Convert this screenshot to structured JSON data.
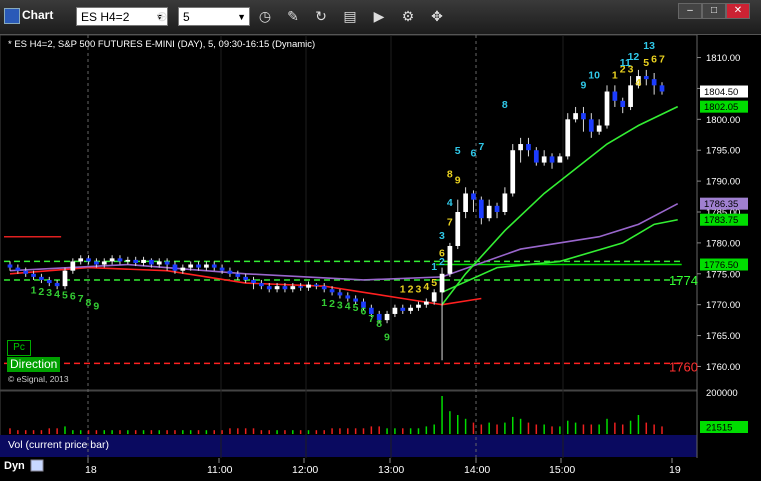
{
  "window": {
    "title": "Chart"
  },
  "toolbar": {
    "symbol": "ES H4=2",
    "interval": "5"
  },
  "chart_data": {
    "type": "candlestick",
    "header": "* ES H4=2, S&P 500 FUTURES E-MINI (DAY), 5, 09:30-16:15 (Dynamic)",
    "price_axis": {
      "range": [
        1757,
        1813
      ],
      "ticks": [
        "1810.00",
        "1805.00",
        "1800.00",
        "1795.00",
        "1790.00",
        "1785.00",
        "1780.00",
        "1775.00",
        "1770.00",
        "1765.00",
        "1760.00"
      ]
    },
    "time_axis": {
      "ticks": [
        "18",
        "11:00",
        "12:00",
        "13:00",
        "14:00",
        "15:00",
        "19"
      ]
    },
    "price_markers": [
      {
        "value": 1804.5,
        "label": "1804.50",
        "color": "#ffffff"
      },
      {
        "value": 1802.05,
        "label": "1802.05",
        "color": "#00dd00"
      },
      {
        "value": 1786.35,
        "label": "1786.35",
        "color": "#a080d0"
      },
      {
        "value": 1783.75,
        "label": "1783.75",
        "color": "#00dd00"
      },
      {
        "value": 1776.5,
        "label": "1776.50",
        "color": "#00dd00"
      }
    ],
    "level_labels": [
      {
        "value": 1774,
        "label": "1774",
        "color": "#33ff33"
      },
      {
        "value": 1760,
        "label": "1760",
        "color": "#ff3030"
      }
    ],
    "candles": [
      [
        1776.5,
        1776,
        1777,
        1775.5
      ],
      [
        1776,
        1775.5,
        1776.5,
        1775
      ],
      [
        1775.5,
        1775,
        1776,
        1774.5
      ],
      [
        1775,
        1774.5,
        1775.5,
        1774
      ],
      [
        1774.5,
        1774,
        1775,
        1773.5
      ],
      [
        1774,
        1773.5,
        1774.5,
        1773
      ],
      [
        1773.5,
        1773,
        1774,
        1772.5
      ],
      [
        1773,
        1775.5,
        1776,
        1772.5
      ],
      [
        1775.5,
        1777,
        1777.5,
        1775
      ],
      [
        1777,
        1777.5,
        1778,
        1776.5
      ],
      [
        1777.5,
        1777,
        1778,
        1776.5
      ],
      [
        1777,
        1776.5,
        1777.5,
        1776
      ],
      [
        1776.5,
        1777,
        1777.5,
        1776
      ],
      [
        1777,
        1777.5,
        1778,
        1776.5
      ],
      [
        1777.5,
        1777,
        1778,
        1776.5
      ],
      [
        1777,
        1777.25,
        1777.75,
        1776.5
      ],
      [
        1777.25,
        1776.75,
        1777.75,
        1776.25
      ],
      [
        1776.75,
        1777.25,
        1777.75,
        1776.25
      ],
      [
        1777.25,
        1776.5,
        1777.5,
        1776
      ],
      [
        1776.5,
        1777,
        1777.5,
        1776
      ],
      [
        1777,
        1776.5,
        1777.5,
        1775.5
      ],
      [
        1776.5,
        1775.5,
        1777,
        1775
      ],
      [
        1775.5,
        1776,
        1776.5,
        1775
      ],
      [
        1776,
        1776.5,
        1777,
        1775.5
      ],
      [
        1776.5,
        1776,
        1777,
        1775.5
      ],
      [
        1776,
        1776.5,
        1777,
        1775.5
      ],
      [
        1776.5,
        1776,
        1777,
        1775.5
      ],
      [
        1776,
        1775.5,
        1776.5,
        1775
      ],
      [
        1775.5,
        1775,
        1776,
        1774.5
      ],
      [
        1775,
        1774.5,
        1775.5,
        1774
      ],
      [
        1774.5,
        1774,
        1775,
        1773.5
      ],
      [
        1774,
        1773.5,
        1774.5,
        1772.5
      ],
      [
        1773.5,
        1773,
        1774,
        1772.5
      ],
      [
        1773,
        1772.5,
        1773.5,
        1772
      ],
      [
        1772.5,
        1773,
        1773.5,
        1772
      ],
      [
        1773,
        1772.5,
        1773.5,
        1772
      ],
      [
        1772.5,
        1773,
        1773.5,
        1772
      ],
      [
        1773,
        1772.75,
        1773.5,
        1772.25
      ],
      [
        1772.75,
        1773.25,
        1773.75,
        1772.25
      ],
      [
        1773.25,
        1773,
        1773.5,
        1772.5
      ],
      [
        1773,
        1772.5,
        1773.5,
        1772
      ],
      [
        1772.5,
        1772,
        1773,
        1771.5
      ],
      [
        1772,
        1771.5,
        1772.5,
        1771
      ],
      [
        1771.5,
        1771,
        1772,
        1770.5
      ],
      [
        1771,
        1770.5,
        1771.5,
        1770
      ],
      [
        1770.5,
        1769.5,
        1771,
        1769
      ],
      [
        1769.5,
        1768.5,
        1770,
        1768
      ],
      [
        1768.5,
        1767.5,
        1769,
        1767
      ],
      [
        1767.5,
        1768.5,
        1769,
        1767
      ],
      [
        1768.5,
        1769.5,
        1770,
        1768
      ],
      [
        1769.5,
        1769,
        1770,
        1768.5
      ],
      [
        1769,
        1769.5,
        1770,
        1768.5
      ],
      [
        1769.5,
        1770,
        1770.5,
        1769
      ],
      [
        1770,
        1770.5,
        1771,
        1769.5
      ],
      [
        1770.5,
        1772,
        1772.5,
        1770
      ],
      [
        1772,
        1775,
        1776,
        1761
      ],
      [
        1775,
        1779.5,
        1780,
        1774.5
      ],
      [
        1779.5,
        1785,
        1787,
        1779
      ],
      [
        1785,
        1788,
        1789,
        1784
      ],
      [
        1788,
        1787,
        1788.5,
        1785
      ],
      [
        1787,
        1784,
        1787.5,
        1783
      ],
      [
        1784,
        1786,
        1787,
        1783.5
      ],
      [
        1786,
        1785,
        1786.5,
        1784
      ],
      [
        1785,
        1788,
        1789,
        1784.5
      ],
      [
        1788,
        1795,
        1796,
        1787.5
      ],
      [
        1795,
        1796,
        1797,
        1793
      ],
      [
        1796,
        1795,
        1797,
        1794
      ],
      [
        1795,
        1793,
        1795.5,
        1792.5
      ],
      [
        1793,
        1794,
        1795,
        1792.5
      ],
      [
        1794,
        1793,
        1794.5,
        1792
      ],
      [
        1793,
        1794,
        1794.5,
        1793
      ],
      [
        1794,
        1800,
        1801,
        1793.5
      ],
      [
        1800,
        1801,
        1802,
        1799.5
      ],
      [
        1801,
        1800,
        1802,
        1798
      ],
      [
        1800,
        1798,
        1801,
        1797
      ],
      [
        1798,
        1799,
        1800,
        1797.5
      ],
      [
        1799,
        1804.5,
        1805.5,
        1798.5
      ],
      [
        1804.5,
        1803,
        1805.5,
        1802
      ],
      [
        1803,
        1802,
        1803.5,
        1801
      ],
      [
        1802,
        1805.5,
        1807,
        1801.5
      ],
      [
        1805.5,
        1807,
        1808,
        1805
      ],
      [
        1807,
        1806.5,
        1808,
        1805.5
      ],
      [
        1806.5,
        1805.5,
        1807.5,
        1804
      ],
      [
        1805.5,
        1804.5,
        1806,
        1804
      ]
    ],
    "series": [
      {
        "name": "",
        "color": "#ff2020",
        "values": [
          [
            0,
            1775
          ],
          [
            10,
            1776
          ],
          [
            20,
            1775.5
          ],
          [
            30,
            1773.5
          ],
          [
            40,
            1773
          ],
          [
            45,
            1772
          ],
          [
            50,
            1771
          ],
          [
            55,
            1770
          ],
          [
            60,
            1771
          ]
        ]
      },
      {
        "name": "",
        "color": "#9966cc",
        "values": [
          [
            0,
            1775.5
          ],
          [
            15,
            1776.5
          ],
          [
            30,
            1775
          ],
          [
            45,
            1774
          ],
          [
            55,
            1774.5
          ],
          [
            65,
            1779
          ],
          [
            75,
            1781
          ],
          [
            80,
            1783
          ],
          [
            85,
            1786.35
          ]
        ]
      },
      {
        "name": "",
        "color": "#33ee33",
        "values": [
          [
            55,
            1770
          ],
          [
            58,
            1775
          ],
          [
            63,
            1782
          ],
          [
            68,
            1788
          ],
          [
            72,
            1792
          ],
          [
            76,
            1796
          ],
          [
            80,
            1799
          ],
          [
            85,
            1802.05
          ]
        ]
      },
      {
        "name": "",
        "color": "#33ee33",
        "values": [
          [
            55,
            1772
          ],
          [
            62,
            1776
          ],
          [
            70,
            1777
          ],
          [
            78,
            1780
          ],
          [
            82,
            1783
          ],
          [
            85,
            1783.75
          ]
        ]
      }
    ],
    "levels": [
      {
        "value": 1781,
        "color": "#e02020",
        "from": 0,
        "to": 6,
        "dash": false
      },
      {
        "value": 1777,
        "color": "#33ee33",
        "from": 0,
        "to": 85,
        "dash": true
      },
      {
        "value": 1774,
        "color": "#33ee33",
        "from": 0,
        "to": 85,
        "dash": true
      },
      {
        "value": 1776.5,
        "color": "#00dd00",
        "from": 55,
        "to": 85,
        "dash": false
      },
      {
        "value": 1760.5,
        "color": "#ff2020",
        "from": 0,
        "to": 85,
        "dash": true
      }
    ],
    "counts": [
      {
        "text": "1",
        "i": 3,
        "price": 1771.8,
        "color": "#33cc33"
      },
      {
        "text": "2",
        "i": 4,
        "price": 1771.6,
        "color": "#33cc33"
      },
      {
        "text": "3",
        "i": 5,
        "price": 1771.4,
        "color": "#33cc33"
      },
      {
        "text": "4",
        "i": 6,
        "price": 1771.2,
        "color": "#33cc33"
      },
      {
        "text": "5",
        "i": 7,
        "price": 1771.0,
        "color": "#33cc33"
      },
      {
        "text": "6",
        "i": 8,
        "price": 1770.8,
        "color": "#33cc33"
      },
      {
        "text": "7",
        "i": 9,
        "price": 1770.4,
        "color": "#33cc33"
      },
      {
        "text": "8",
        "i": 10,
        "price": 1769.8,
        "color": "#33cc33"
      },
      {
        "text": "9",
        "i": 11,
        "price": 1769.2,
        "color": "#33cc33"
      },
      {
        "text": "1",
        "i": 40,
        "price": 1769.8,
        "color": "#33cc33"
      },
      {
        "text": "2",
        "i": 41,
        "price": 1769.6,
        "color": "#33cc33"
      },
      {
        "text": "3",
        "i": 42,
        "price": 1769.4,
        "color": "#33cc33"
      },
      {
        "text": "4",
        "i": 43,
        "price": 1769.2,
        "color": "#33cc33"
      },
      {
        "text": "5",
        "i": 44,
        "price": 1769.0,
        "color": "#33cc33"
      },
      {
        "text": "6",
        "i": 45,
        "price": 1768.4,
        "color": "#33cc33"
      },
      {
        "text": "7",
        "i": 46,
        "price": 1767.2,
        "color": "#33cc33"
      },
      {
        "text": "8",
        "i": 47,
        "price": 1766.4,
        "color": "#33cc33"
      },
      {
        "text": "9",
        "i": 48,
        "price": 1764.2,
        "color": "#33cc33"
      },
      {
        "text": "1",
        "i": 50,
        "price": 1772.0,
        "color": "#e8d020"
      },
      {
        "text": "2",
        "i": 51,
        "price": 1772.0,
        "color": "#e8d020"
      },
      {
        "text": "3",
        "i": 52,
        "price": 1772.0,
        "color": "#e8d020"
      },
      {
        "text": "4",
        "i": 53,
        "price": 1772.4,
        "color": "#e8d020"
      },
      {
        "text": "5",
        "i": 54,
        "price": 1773.0,
        "color": "#e8d020"
      },
      {
        "text": "6",
        "i": 55,
        "price": 1777.8,
        "color": "#e8d020"
      },
      {
        "text": "7",
        "i": 56,
        "price": 1782.8,
        "color": "#e8d020"
      },
      {
        "text": "8",
        "i": 56,
        "price": 1790.6,
        "color": "#e8d020"
      },
      {
        "text": "9",
        "i": 57,
        "price": 1789.6,
        "color": "#e8d020"
      },
      {
        "text": "1",
        "i": 54,
        "price": 1775.6,
        "color": "#30c8e8"
      },
      {
        "text": "2",
        "i": 55,
        "price": 1776.4,
        "color": "#30c8e8"
      },
      {
        "text": "3",
        "i": 55,
        "price": 1780.6,
        "color": "#30c8e8"
      },
      {
        "text": "4",
        "i": 56,
        "price": 1786.0,
        "color": "#30c8e8"
      },
      {
        "text": "5",
        "i": 57,
        "price": 1794.4,
        "color": "#30c8e8"
      },
      {
        "text": "6",
        "i": 59,
        "price": 1794.0,
        "color": "#30c8e8"
      },
      {
        "text": "7",
        "i": 60,
        "price": 1795.0,
        "color": "#30c8e8"
      },
      {
        "text": "8",
        "i": 63,
        "price": 1801.8,
        "color": "#30c8e8"
      },
      {
        "text": "9",
        "i": 73,
        "price": 1805.0,
        "color": "#30c8e8"
      },
      {
        "text": "10",
        "i": 74,
        "price": 1806.6,
        "color": "#30c8e8"
      },
      {
        "text": "1",
        "i": 77,
        "price": 1806.6,
        "color": "#e8d020"
      },
      {
        "text": "2",
        "i": 78,
        "price": 1807.6,
        "color": "#e8d020"
      },
      {
        "text": "3",
        "i": 79,
        "price": 1807.6,
        "color": "#e8d020"
      },
      {
        "text": "4",
        "i": 80,
        "price": 1805.4,
        "color": "#e8d020"
      },
      {
        "text": "5",
        "i": 81,
        "price": 1808.6,
        "color": "#e8d020"
      },
      {
        "text": "6",
        "i": 82,
        "price": 1809.2,
        "color": "#e8d020"
      },
      {
        "text": "7",
        "i": 83,
        "price": 1809.2,
        "color": "#e8d020"
      },
      {
        "text": "11",
        "i": 78,
        "price": 1808.6,
        "color": "#30c8e8"
      },
      {
        "text": "12",
        "i": 79,
        "price": 1809.6,
        "color": "#30c8e8"
      },
      {
        "text": "13",
        "i": 81,
        "price": 1811.4,
        "color": "#30c8e8"
      }
    ],
    "volume_axis": {
      "ticks": [
        "200000"
      ],
      "last": "21515"
    },
    "volume": [
      3,
      2,
      2,
      2,
      2,
      3,
      3,
      4,
      2,
      2,
      2,
      2,
      2,
      2,
      2,
      2,
      2,
      2,
      2,
      2,
      2,
      2,
      2,
      2,
      2,
      2,
      2,
      2,
      3,
      3,
      3,
      3,
      2,
      2,
      2,
      2,
      2,
      2,
      2,
      2,
      2,
      3,
      3,
      3,
      3,
      3,
      4,
      4,
      3,
      3,
      3,
      3,
      3,
      4,
      5,
      20,
      12,
      10,
      8,
      6,
      5,
      6,
      5,
      6,
      9,
      8,
      6,
      5,
      5,
      4,
      4,
      7,
      6,
      5,
      5,
      5,
      8,
      6,
      5,
      7,
      10,
      6,
      5,
      4
    ]
  },
  "indicators": {
    "pc": "Pc",
    "direction": "Direction",
    "copyright": "© eSignal, 2013"
  },
  "volume_panel": {
    "label": "Vol (current price bar)"
  },
  "bottom": {
    "dyn": "Dyn"
  }
}
